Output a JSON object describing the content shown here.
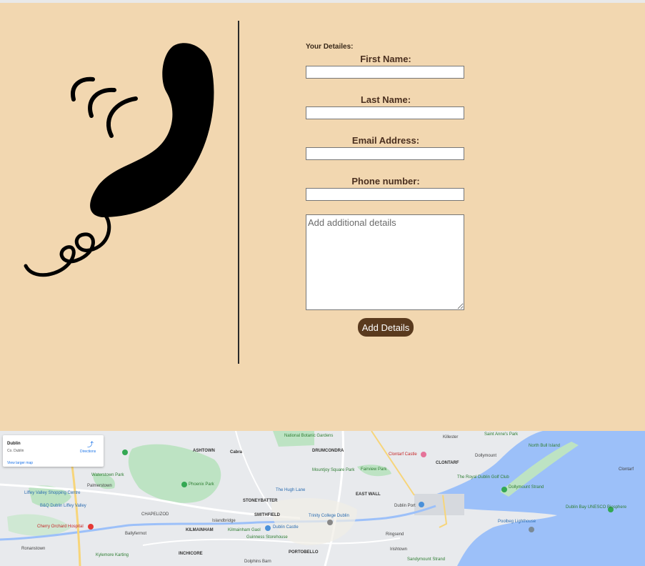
{
  "form": {
    "heading": "Your Detailes:",
    "fields": [
      {
        "label": "First Name:",
        "value": ""
      },
      {
        "label": "Last Name:",
        "value": ""
      },
      {
        "label": "Email Address:",
        "value": ""
      },
      {
        "label": "Phone number:",
        "value": ""
      }
    ],
    "details_placeholder": "Add additional details",
    "submit_label": "Add Details"
  },
  "map": {
    "place_title": "Dublin",
    "place_subtitle": "Co. Dublin",
    "directions_label": "Directions",
    "larger_map_label": "View larger map",
    "labels": [
      "ASHTOWN",
      "Cabra",
      "National Botanic Gardens",
      "DRUMCONDRA",
      "Clontarf Castle",
      "CLONTARF",
      "Killester",
      "Saint Anne's Park",
      "Dollymount",
      "North Bull Island",
      "Phoenix Park",
      "STONEYBATTER",
      "The Hugh Lane",
      "Mountjoy Square Park",
      "Fairview Park",
      "EAST WALL",
      "Dublin Port",
      "The Royal Dublin Golf Club",
      "Dollymount Strand",
      "Palmerstown",
      "Waterstown Park",
      "Liffey Valley Shopping Centre",
      "B&Q Dublin Liffey Valley",
      "SMITHFIELD",
      "Trinity College Dublin",
      "Islandbridge",
      "KILMAINHAM",
      "Kilmainham Gaol",
      "Dublin Castle",
      "Guinness Storehouse",
      "Ringsend",
      "Poolbeg Lighthouse",
      "Dublin Bay UNESCO Biosphere",
      "Cherry Orchard Hospital",
      "Ballyfermot",
      "Ronanstown",
      "Kylemore Karting",
      "INCHICORE",
      "PORTOBELLO",
      "Irishtown",
      "Sandymount Strand",
      "Dolphins Barn",
      "CHAPELIZOD",
      "Clontarf"
    ]
  },
  "colors": {
    "section_bg": "#f2d7b0",
    "label_color": "#4a2f1f",
    "button_bg": "#5a3a1e",
    "sea": "#9cc0f9",
    "park": "#bde3c3"
  },
  "icons": [
    "telephone-handset-icon",
    "directions-icon",
    "map-pin-icon"
  ]
}
